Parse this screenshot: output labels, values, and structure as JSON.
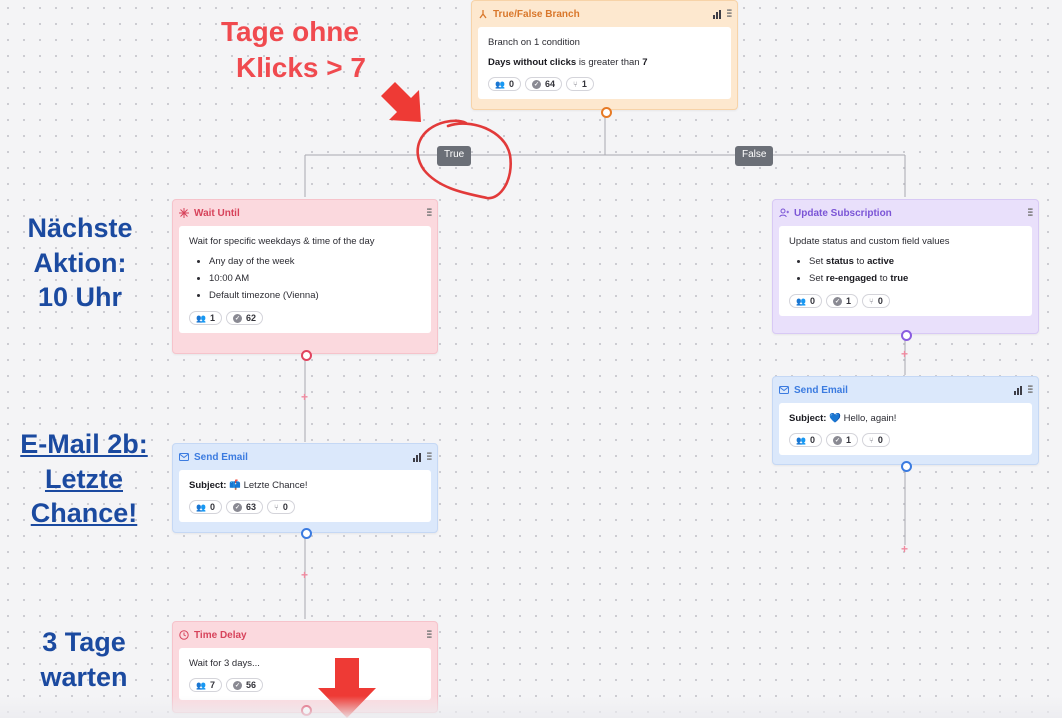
{
  "colors": {
    "annotation_red": "#f04a4f",
    "annotation_blue": "#1b4aa0",
    "branch_orange": "#d9772b",
    "wait_red": "#d7435b",
    "email_blue": "#3b7be0",
    "update_purple": "#7b55d6"
  },
  "annotations": {
    "branch_note_line1": "Tage ohne",
    "branch_note_line2": "Klicks > 7",
    "next_action_line1": "Nächste",
    "next_action_line2": "Aktion:",
    "next_action_line3": "10 Uhr",
    "email_note_line1": "E-Mail 2b:",
    "email_note_line2": "Letzte",
    "email_note_line3": "Chance!",
    "wait_note_line1": "3 Tage",
    "wait_note_line2": "warten"
  },
  "edges": {
    "true_label": "True",
    "false_label": "False"
  },
  "branch": {
    "title": "True/False Branch",
    "description": "Branch on 1 condition",
    "condition_field": "Days without clicks",
    "condition_op": "is greater than",
    "condition_value": "7",
    "stats": {
      "active": "0",
      "completed": "64",
      "branched": "1"
    }
  },
  "wait_until": {
    "title": "Wait Until",
    "description": "Wait for specific weekdays & time of the day",
    "items": [
      "Any day of the week",
      "10:00 AM",
      "Default timezone (Vienna)"
    ],
    "stats": {
      "active": "1",
      "completed": "62"
    }
  },
  "send_email_left": {
    "title": "Send Email",
    "subject_label": "Subject:",
    "subject_icon": "📫",
    "subject_text": "Letzte Chance!",
    "stats": {
      "active": "0",
      "completed": "63",
      "branched": "0"
    }
  },
  "time_delay": {
    "title": "Time Delay",
    "description": "Wait for 3 days...",
    "stats": {
      "active": "7",
      "completed": "56"
    }
  },
  "update_subscription": {
    "title": "Update Subscription",
    "description": "Update status and custom field values",
    "item1_prefix": "Set",
    "item1_field": "status",
    "item1_mid": "to",
    "item1_value": "active",
    "item2_prefix": "Set",
    "item2_field": "re-engaged",
    "item2_mid": "to",
    "item2_value": "true",
    "stats": {
      "active": "0",
      "completed": "1",
      "branched": "0"
    }
  },
  "send_email_right": {
    "title": "Send Email",
    "subject_label": "Subject:",
    "subject_icon": "💙",
    "subject_text": "Hello, again!",
    "stats": {
      "active": "0",
      "completed": "1",
      "branched": "0"
    }
  }
}
